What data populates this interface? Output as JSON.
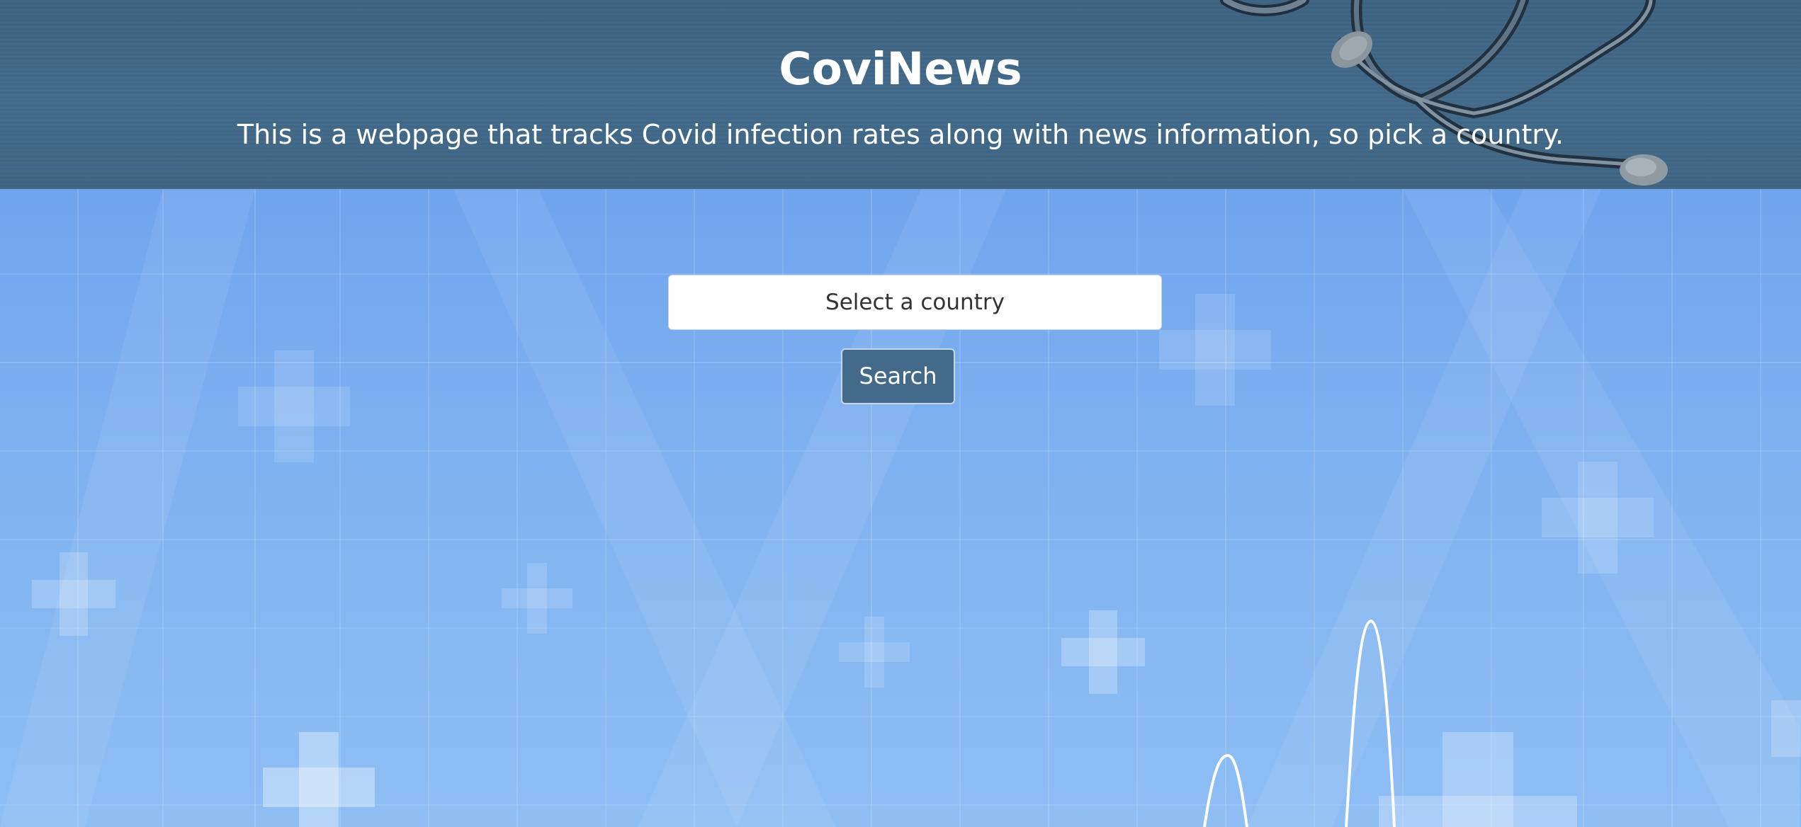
{
  "header": {
    "title": "CoviNews",
    "tagline": "This is a webpage that tracks Covid infection rates along with news information, so pick a country."
  },
  "search": {
    "select_value": "Select a country",
    "button_label": "Search"
  },
  "colors": {
    "header_bg": "#426a8a",
    "body_bg": "#7fb0ef",
    "button_bg": "#436a89",
    "text_light": "#ffffff"
  },
  "icons": {
    "header_image": "stethoscope-icon",
    "background_decoration": "medical-cross-icon",
    "pulse_line": "heartbeat-line-icon"
  }
}
